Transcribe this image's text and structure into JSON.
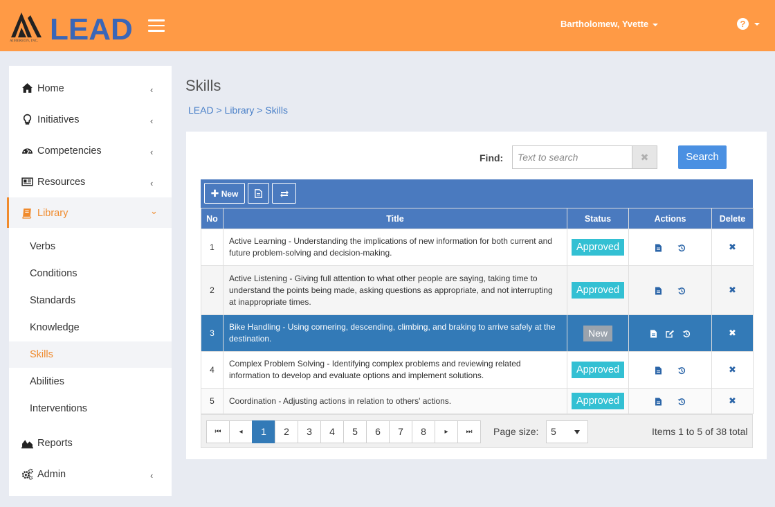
{
  "header": {
    "logo_text": "LEAD",
    "logo_sub": "AIMEREON, INC.",
    "user_name": "Bartholomew, Yvette",
    "help_glyph": "?",
    "accent_color": "#ff9a45"
  },
  "sidebar": {
    "items": [
      {
        "label": "Home",
        "icon": "home-icon",
        "chevron": "‹"
      },
      {
        "label": "Initiatives",
        "icon": "lightbulb-icon",
        "chevron": "‹"
      },
      {
        "label": "Competencies",
        "icon": "dashboard-icon",
        "chevron": "‹"
      },
      {
        "label": "Resources",
        "icon": "newspaper-icon",
        "chevron": "‹"
      },
      {
        "label": "Library",
        "icon": "book-icon",
        "chevron": "⌄"
      },
      {
        "label": "Reports",
        "icon": "area-chart-icon"
      },
      {
        "label": "Admin",
        "icon": "gears-icon",
        "chevron": "‹"
      }
    ],
    "library_sub": [
      "Verbs",
      "Conditions",
      "Standards",
      "Knowledge",
      "Skills",
      "Abilities",
      "Interventions"
    ],
    "active_color": "#f08a2c"
  },
  "page": {
    "title": "Skills",
    "breadcrumb": "LEAD > Library > Skills"
  },
  "search": {
    "label": "Find:",
    "placeholder": "Text to search",
    "clear_glyph": "✖",
    "button": "Search"
  },
  "toolbar": {
    "new_label": "New"
  },
  "grid": {
    "columns": [
      "No",
      "Title",
      "Status",
      "Actions",
      "Delete"
    ],
    "rows": [
      {
        "no": "1",
        "title": "Active Learning - Understanding the implications of new information for both current and future problem-solving and decision-making.",
        "status": "Approved"
      },
      {
        "no": "2",
        "title": "Active Listening - Giving full attention to what other people are saying, taking time to understand the points being made, asking questions as appropriate, and not interrupting at inappropriate times.",
        "status": "Approved"
      },
      {
        "no": "3",
        "title": "Bike Handling - Using cornering, descending, climbing, and braking to arrive safely at the destination.",
        "status": "New"
      },
      {
        "no": "4",
        "title": "Complex Problem Solving - Identifying complex problems and reviewing related information to develop and evaluate options and implement solutions.",
        "status": "Approved"
      },
      {
        "no": "5",
        "title": "Coordination - Adjusting actions in relation to others' actions.",
        "status": "Approved"
      }
    ],
    "delete_glyph": "✖"
  },
  "pager": {
    "first": "⏮",
    "prev": "◂",
    "next": "▸",
    "last": "⏭",
    "pages": [
      "1",
      "2",
      "3",
      "4",
      "5",
      "6",
      "7",
      "8"
    ],
    "current": "1",
    "page_size_label": "Page size:",
    "page_size": "5",
    "items_total": "Items 1 to 5 of 38 total"
  }
}
